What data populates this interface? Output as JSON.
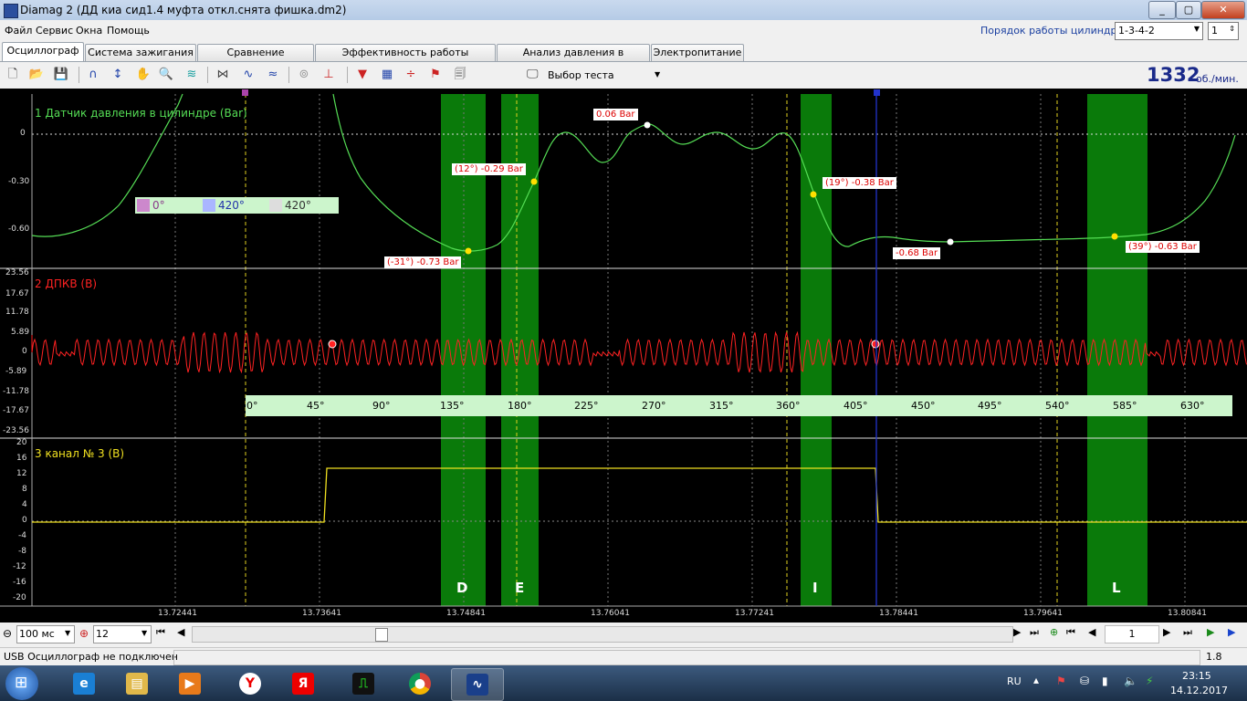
{
  "window": {
    "title": "Diamag 2 (ДД киа сид1.4  муфта откл.снята фишка.dm2)"
  },
  "menu": [
    "Файл",
    "Сервис",
    "Окна",
    "Помощь"
  ],
  "firing_order": {
    "label": "Порядок работы цилиндров",
    "value": "1-3-4-2",
    "cylinder": "1"
  },
  "tabs": [
    "Осциллограф",
    "Система зажигания",
    "Сравнение цилиндров",
    "Эффективность работы цилиндров",
    "Анализ давления в цилиндре",
    "Электропитание"
  ],
  "toolbar": {
    "test_select": "Выбор теста",
    "rpm": "1332",
    "rpm_unit": "об./мин."
  },
  "channels": [
    {
      "name": "1 Датчик давления в цилиндре (Bar)",
      "color": "#55dd55",
      "ticks": [
        "0",
        "-0.30",
        "-0.60"
      ]
    },
    {
      "name": "2 ДПКВ (В)",
      "color": "#ff2222",
      "ticks": [
        "23.56",
        "17.67",
        "11.78",
        "5.89",
        "0",
        "-5.89",
        "-11.78",
        "-17.67",
        "-23.56"
      ]
    },
    {
      "name": "3 канал № 3 (В)",
      "color": "#f0e020",
      "ticks": [
        "20",
        "16",
        "12",
        "8",
        "4",
        "0",
        "-4",
        "-8",
        "-12",
        "-16",
        "-20"
      ]
    }
  ],
  "markers": {
    "m0": "0°",
    "m1": "420°",
    "m2": "420°"
  },
  "annotations": [
    "0.06 Bar",
    "(12°) -0.29 Bar",
    "(19°) -0.38 Bar",
    "(-31°) -0.73 Bar",
    "-0.68 Bar",
    "(39°) -0.63 Bar"
  ],
  "angle_scale": [
    "0°",
    "45°",
    "90°",
    "135°",
    "180°",
    "225°",
    "270°",
    "315°",
    "360°",
    "405°",
    "450°",
    "495°",
    "540°",
    "585°",
    "630°"
  ],
  "zones": [
    "D",
    "E",
    "I",
    "L"
  ],
  "time_axis": [
    "13.72441",
    "13.73641",
    "13.74841",
    "13.76041",
    "13.77241",
    "13.78441",
    "13.79641",
    "13.80841"
  ],
  "controls": {
    "timebase": "100 мс",
    "count": "12",
    "page": "1"
  },
  "status": {
    "text": "USB Осциллограф не подключен",
    "version": "1.8"
  },
  "tray": {
    "lang": "RU",
    "time": "23:15",
    "date": "14.12.2017"
  },
  "colors": {
    "zone": "#0a7a0a",
    "scale_bg": "#ccf5cc"
  },
  "cursor_sync_color": "#2233cc"
}
